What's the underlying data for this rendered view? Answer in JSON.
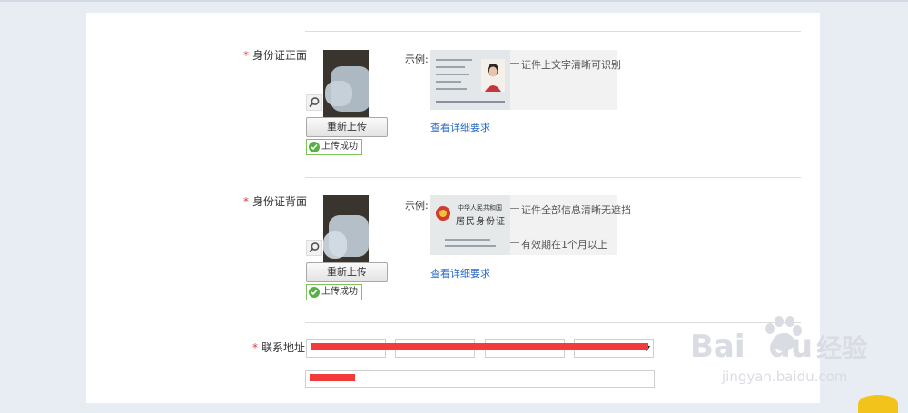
{
  "form": {
    "required_mark": "*",
    "id_front": {
      "label": "身份证正面",
      "reupload_button": "重新上传",
      "status": "上传成功",
      "example_label": "示例:",
      "annotations": [
        "证件上文字清晰可识别"
      ],
      "detail_link": "查看详细要求"
    },
    "id_back": {
      "label": "身份证背面",
      "reupload_button": "重新上传",
      "status": "上传成功",
      "example_label": "示例:",
      "card_title_small": "中华人民共和国",
      "card_title_big": "居民身份证",
      "annotations": [
        "证件全部信息清晰无遮挡",
        "有效期在1个月以上"
      ],
      "detail_link": "查看详细要求"
    },
    "address": {
      "label": "联系地址",
      "dropdown_icon": "caret-down-icon"
    }
  },
  "watermark": {
    "brand": "Bai",
    "brand2": "du",
    "cn": "经验",
    "url": "jingyan.baidu.com"
  },
  "colors": {
    "required": "#e4393c",
    "link": "#2a6bc6",
    "success_border": "#7ec35a",
    "redaction": "#f33b3b"
  }
}
